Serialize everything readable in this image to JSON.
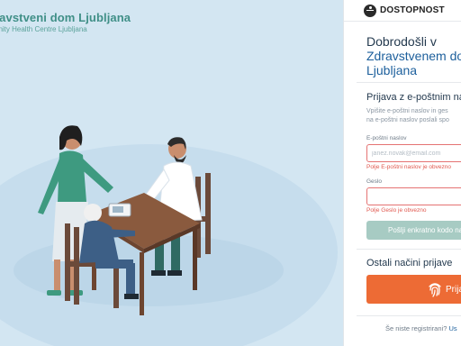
{
  "logo": {
    "line1": "ravstveni dom Ljubljana",
    "line2": "unity Health Centre Ljubljana"
  },
  "accessibility": {
    "label": "DOSTOPNOST",
    "icon": "accessibility-icon"
  },
  "welcome": {
    "line1": "Dobrodošli v",
    "line2": "Zdravstvenem do",
    "line3": "Ljubljana"
  },
  "email_login": {
    "title": "Prijava z e-poštnim nas",
    "desc_line1": "Vpišite e-poštni naslov in ges",
    "desc_line2": "na e-poštni naslov poslali spo",
    "email_label": "E-poštni naslov",
    "email_placeholder": "janez.novak@email.com",
    "email_value": "",
    "email_error": "Polje E-poštni naslov je obvezno",
    "password_label": "Geslo",
    "password_value": "",
    "password_error": "Polje Geslo je obvezno",
    "send_button": "Pošlji enkratno kodo na"
  },
  "other_login": {
    "title": "Ostali načini prijave",
    "fingerprint_button": "Prijava s",
    "icon": "fingerprint-icon"
  },
  "register": {
    "text": "Še niste registrirani?",
    "link": "Us"
  },
  "colors": {
    "hero_bg": "#d3e6f2",
    "brand_teal": "#3f8f87",
    "error_red": "#e0584f",
    "orange": "#ed6b35",
    "muted_teal_button": "#a7cbc3",
    "heading_blue": "#1c5f9c"
  }
}
